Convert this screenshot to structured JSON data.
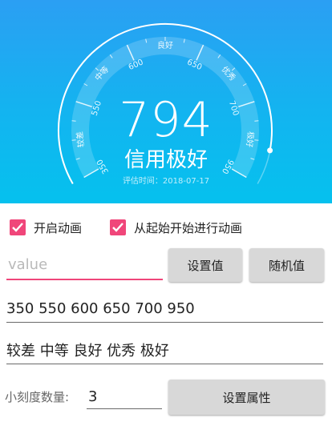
{
  "gauge": {
    "score": "794",
    "level_text": "信用极好",
    "date_text": "评估时间：2018-07-17",
    "scale_values": [
      "350",
      "550",
      "600",
      "650",
      "700",
      "950"
    ],
    "range_labels": [
      "较差",
      "中等",
      "良好",
      "优秀",
      "极好"
    ],
    "progress_fraction": 0.92
  },
  "options": {
    "animate_label": "开启动画",
    "animate_checked": true,
    "from_start_label": "从起始开始进行动画",
    "from_start_checked": true
  },
  "value_input": {
    "value": "",
    "placeholder": "value"
  },
  "buttons": {
    "set_value": "设置值",
    "random_value": "随机值",
    "set_attrs": "设置属性"
  },
  "scale_input": {
    "value": "350 550 600 650 700 950"
  },
  "labels_input": {
    "value": "较差 中等 良好 优秀 极好"
  },
  "tick_count": {
    "label": "小刻度数量:",
    "value": "3"
  },
  "colors": {
    "accent": "#f0467a",
    "header_top": "#2b9ff3",
    "header_bottom": "#05c1ee",
    "button_bg": "#d8d8d8"
  }
}
